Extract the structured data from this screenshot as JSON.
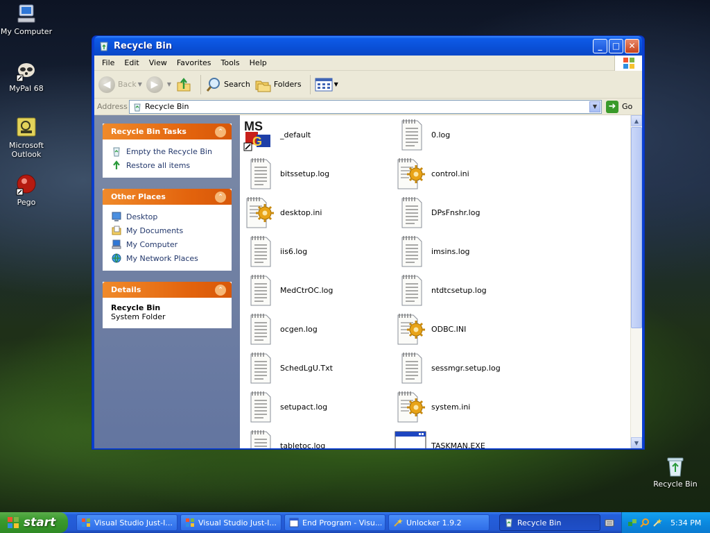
{
  "desktop": {
    "icons": [
      {
        "label": "My Computer"
      },
      {
        "label": "MyPal 68"
      },
      {
        "label": "Microsoft Outlook"
      },
      {
        "label": "Pego"
      },
      {
        "label": "Recycle Bin"
      }
    ]
  },
  "window": {
    "title": "Recycle Bin",
    "menu": [
      "File",
      "Edit",
      "View",
      "Favorites",
      "Tools",
      "Help"
    ],
    "toolbar": {
      "back": "Back",
      "search": "Search",
      "folders": "Folders"
    },
    "address": {
      "label": "Address",
      "value": "Recycle Bin",
      "go": "Go"
    },
    "taskpane": {
      "tasks_title": "Recycle Bin Tasks",
      "tasks": [
        "Empty the Recycle Bin",
        "Restore all items"
      ],
      "places_title": "Other Places",
      "places": [
        "Desktop",
        "My Documents",
        "My Computer",
        "My Network Places"
      ],
      "details_title": "Details",
      "details_name": "Recycle Bin",
      "details_type": "System Folder"
    },
    "files": [
      {
        "name": "_default",
        "icon": "msg-icon"
      },
      {
        "name": "0.log",
        "icon": "text-file-icon"
      },
      {
        "name": "bitssetup.log",
        "icon": "text-file-icon"
      },
      {
        "name": "control.ini",
        "icon": "config-file-icon"
      },
      {
        "name": "desktop.ini",
        "icon": "config-file-icon"
      },
      {
        "name": "DPsFnshr.log",
        "icon": "text-file-icon"
      },
      {
        "name": "iis6.log",
        "icon": "text-file-icon"
      },
      {
        "name": "imsins.log",
        "icon": "text-file-icon"
      },
      {
        "name": "MedCtrOC.log",
        "icon": "text-file-icon"
      },
      {
        "name": "ntdtcsetup.log",
        "icon": "text-file-icon"
      },
      {
        "name": "ocgen.log",
        "icon": "text-file-icon"
      },
      {
        "name": "ODBC.INI",
        "icon": "config-file-icon"
      },
      {
        "name": "SchedLgU.Txt",
        "icon": "text-file-icon"
      },
      {
        "name": "sessmgr.setup.log",
        "icon": "text-file-icon"
      },
      {
        "name": "setupact.log",
        "icon": "text-file-icon"
      },
      {
        "name": "system.ini",
        "icon": "config-file-icon"
      },
      {
        "name": "tabletoc.log",
        "icon": "text-file-icon"
      },
      {
        "name": "TASKMAN.EXE",
        "icon": "exe-icon"
      }
    ]
  },
  "taskbar": {
    "start": "start",
    "tasks": [
      {
        "label": "Visual Studio Just-I...",
        "active": false
      },
      {
        "label": "Visual Studio Just-I...",
        "active": false
      },
      {
        "label": "End Program - Visu...",
        "active": false
      },
      {
        "label": "Unlocker 1.9.2",
        "active": false
      },
      {
        "label": "Recycle Bin",
        "active": true
      }
    ],
    "clock": "5:34 PM"
  }
}
